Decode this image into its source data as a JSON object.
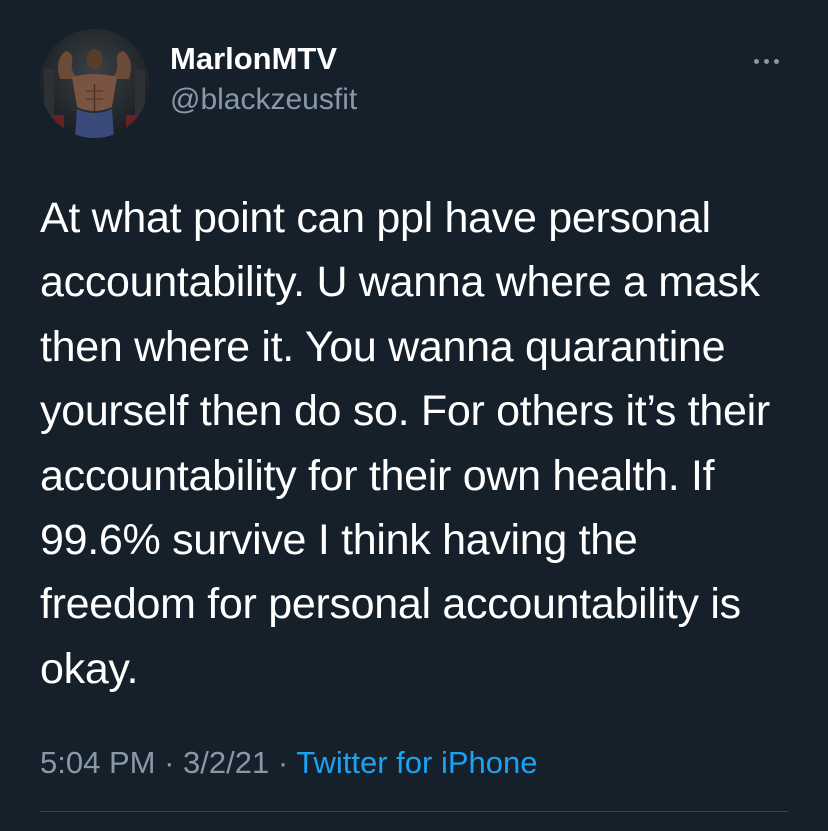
{
  "author": {
    "display_name": "MarlonMTV",
    "handle": "@blackzeusfit",
    "avatar_icon": "profile-photo"
  },
  "menu": {
    "icon": "more-options-icon"
  },
  "tweet": {
    "lines": [
      "At what point can ppl have personal",
      "accountability. U wanna where a mask",
      "then where it. You wanna quarantine",
      "yourself then do so. For others it’s their",
      "accountability for their own health. If",
      "99.6% survive I think having the",
      "freedom for personal accountability is",
      "okay."
    ],
    "time": "5:04 PM",
    "separator": "·",
    "date": "3/2/21",
    "source": "Twitter for iPhone"
  },
  "colors": {
    "background": "#15202b",
    "primary_text": "#ffffff",
    "secondary_text": "#8899a6",
    "link": "#1da1f2",
    "divider": "#38444d"
  }
}
